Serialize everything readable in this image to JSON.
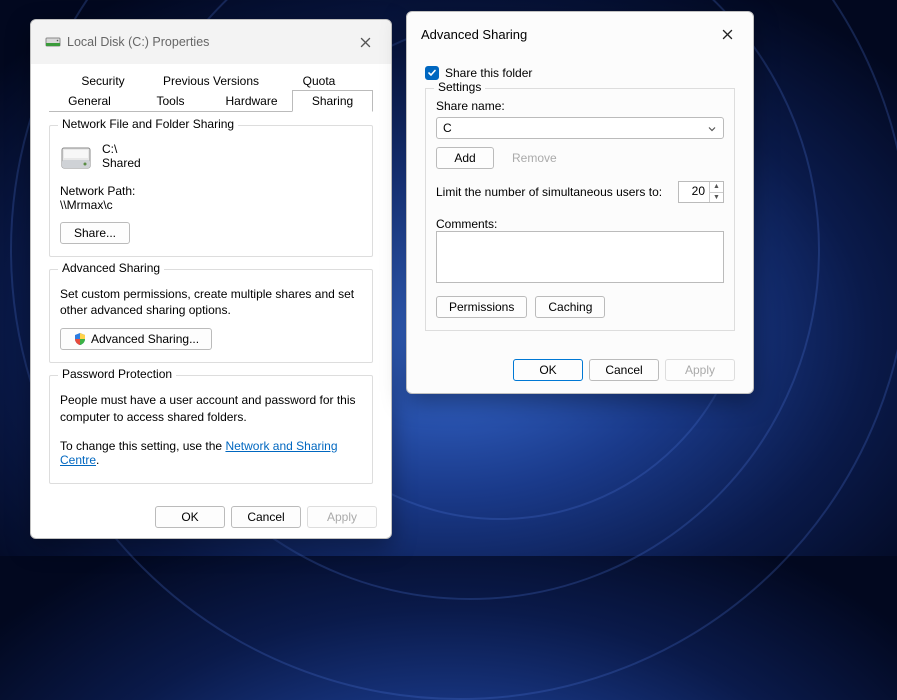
{
  "props": {
    "title": "Local Disk  (C:) Properties",
    "tabs_row1": [
      "Security",
      "Previous Versions",
      "Quota"
    ],
    "tabs_row2": [
      "General",
      "Tools",
      "Hardware",
      "Sharing"
    ],
    "active_tab": "Sharing",
    "group_nfs": {
      "legend": "Network File and Folder Sharing",
      "drive_label": "C:\\",
      "status": "Shared",
      "network_path_label": "Network Path:",
      "network_path": "\\\\Mrmax\\c",
      "share_btn": "Share..."
    },
    "group_adv": {
      "legend": "Advanced Sharing",
      "desc": "Set custom permissions, create multiple shares and set other advanced sharing options.",
      "btn": "Advanced Sharing..."
    },
    "group_pwd": {
      "legend": "Password Protection",
      "desc": "People must have a user account and password for this computer to access shared folders.",
      "change_prefix": "To change this setting, use the ",
      "link": "Network and Sharing Centre",
      "suffix": "."
    },
    "buttons": {
      "ok": "OK",
      "cancel": "Cancel",
      "apply": "Apply"
    }
  },
  "adv": {
    "title": "Advanced Sharing",
    "share_checkbox": "Share this folder",
    "share_checked": true,
    "settings_legend": "Settings",
    "share_name_label": "Share name:",
    "share_name_value": "C",
    "add_btn": "Add",
    "remove_btn": "Remove",
    "limit_label": "Limit the number of simultaneous users to:",
    "limit_value": "20",
    "comments_label": "Comments:",
    "comments_value": "",
    "permissions_btn": "Permissions",
    "caching_btn": "Caching",
    "ok": "OK",
    "cancel": "Cancel",
    "apply": "Apply"
  }
}
